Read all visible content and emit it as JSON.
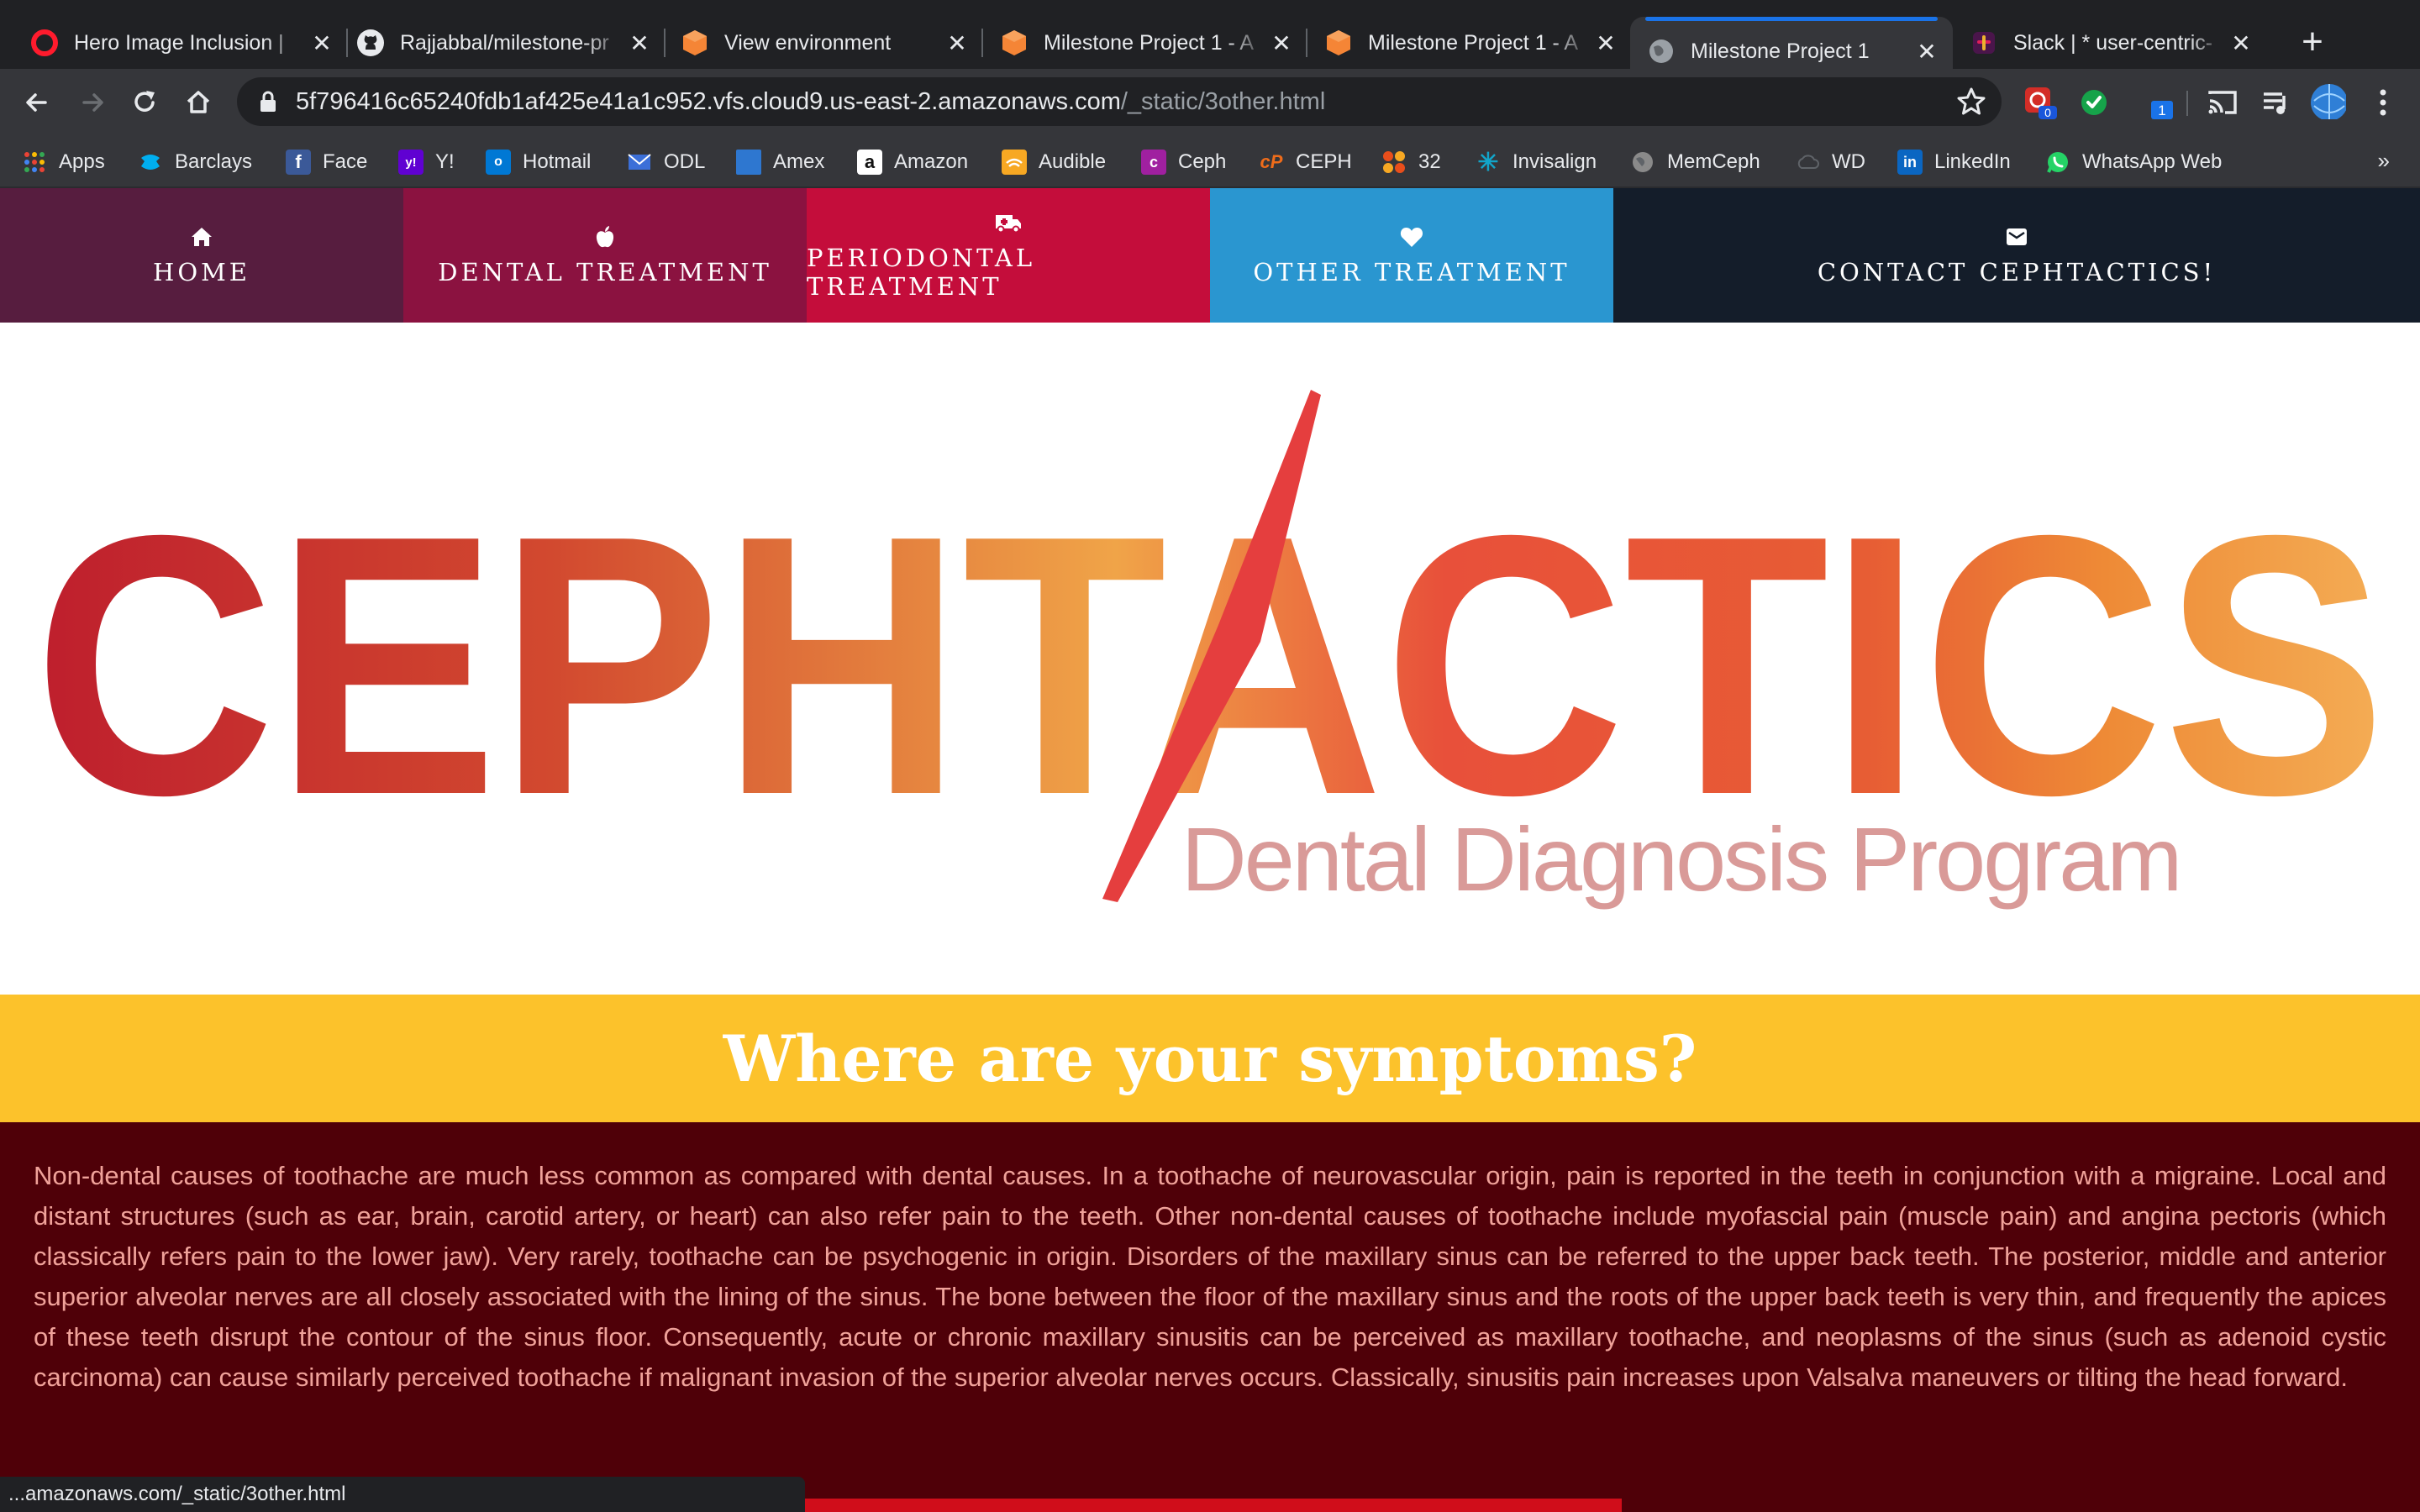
{
  "browser": {
    "tabs": [
      {
        "title": "Hero Image Inclusion |",
        "favicon": "opera-icon",
        "active": false
      },
      {
        "title": "Rajjabbal/milestone-pr",
        "favicon": "github-icon",
        "active": false
      },
      {
        "title": "View environment",
        "favicon": "aws-cube-icon",
        "active": false
      },
      {
        "title": "Milestone Project 1 - A",
        "favicon": "aws-cube-icon",
        "active": false
      },
      {
        "title": "Milestone Project 1 - A",
        "favicon": "aws-cube-icon",
        "active": false
      },
      {
        "title": "Milestone Project 1",
        "favicon": "globe-icon",
        "active": true
      },
      {
        "title": "Slack | * user-centric-",
        "favicon": "slack-icon",
        "active": false
      }
    ],
    "url_host": "5f796416c65240fdb1af425e41a1c952.vfs.cloud9.us-east-2.amazonaws.com",
    "url_path": "/_static/3other.html",
    "extension_badges": {
      "red": "0",
      "blue": "1"
    },
    "bookmarks": [
      {
        "label": "Apps",
        "icon": "apps-grid-icon",
        "color": "#ea4335"
      },
      {
        "label": "Barclays",
        "icon": "barclays-eagle-icon",
        "color": "#00aeef"
      },
      {
        "label": "Face",
        "icon": "facebook-icon",
        "color": "#3b5998"
      },
      {
        "label": "Y!",
        "icon": "yahoo-icon",
        "color": "#6001d2"
      },
      {
        "label": "Hotmail",
        "icon": "outlook-icon",
        "color": "#0078d4"
      },
      {
        "label": "ODL",
        "icon": "mail-icon",
        "color": "#3b6fd8"
      },
      {
        "label": "Amex",
        "icon": "amex-icon",
        "color": "#2e77d0"
      },
      {
        "label": "Amazon",
        "icon": "amazon-icon",
        "color": "#ffffff"
      },
      {
        "label": "Audible",
        "icon": "audible-icon",
        "color": "#f7a823"
      },
      {
        "label": "Ceph",
        "icon": "ceph-icon",
        "color": "#a020a0"
      },
      {
        "label": "CEPH",
        "icon": "ceph-orange-icon",
        "color": "#ef6c1a"
      },
      {
        "label": "32",
        "icon": "thirtytwo-icon",
        "color": "#e94e1b"
      },
      {
        "label": "Invisalign",
        "icon": "invisalign-icon",
        "color": "#12a5c9"
      },
      {
        "label": "MemCeph",
        "icon": "globe-icon",
        "color": "#8a8a8a"
      },
      {
        "label": "WD",
        "icon": "cloud-icon",
        "color": "#5f6368"
      },
      {
        "label": "LinkedIn",
        "icon": "linkedin-icon",
        "color": "#0a66c2"
      },
      {
        "label": "WhatsApp Web",
        "icon": "whatsapp-icon",
        "color": "#25d366"
      }
    ],
    "bookmarks_more": "»",
    "status_url": "...amazonaws.com/_static/3other.html"
  },
  "nav": {
    "items": [
      {
        "label": "HOME",
        "icon": "home-icon",
        "bg": "#571d3f"
      },
      {
        "label": "DENTAL TREATMENT",
        "icon": "apple-icon",
        "bg": "#8b1240"
      },
      {
        "label": "PERIODONTAL TREATMENT",
        "icon": "ambulance-icon",
        "bg": "#c40d3b"
      },
      {
        "label": "OTHER TREATMENT",
        "icon": "heart-icon",
        "bg": "#2a96d0"
      },
      {
        "label": "CONTACT CEPHTACTICS!",
        "icon": "envelope-icon",
        "bg": "#141d2a"
      }
    ]
  },
  "hero": {
    "logo_text": "CEPHTACTICS",
    "tagline": "Dental Diagnosis Program",
    "colors": {
      "start": "#be1e2d",
      "mid": "#e78a3e",
      "accent": "#e53e3e",
      "tagline": "#d99a98"
    }
  },
  "symptoms": {
    "heading": "Where are your symptoms?",
    "band_color": "#fcc22b",
    "body_bg": "#4f0008",
    "body_text": "Non-dental causes of toothache are much less common as compared with dental causes. In a toothache of neurovascular origin, pain is reported in the teeth in conjunction with a migraine. Local and distant structures (such as ear, brain, carotid artery, or heart) can also refer pain to the teeth. Other non-dental causes of toothache include myofascial pain (muscle pain) and angina pectoris (which classically refers pain to the lower jaw). Very rarely, toothache can be psychogenic in origin. Disorders of the maxillary sinus can be referred to the upper back teeth. The posterior, middle and anterior superior alveolar nerves are all closely associated with the lining of the sinus. The bone between the floor of the maxillary sinus and the roots of the upper back teeth is very thin, and frequently the apices of these teeth disrupt the contour of the sinus floor. Consequently, acute or chronic maxillary sinusitis can be perceived as maxillary toothache, and neoplasms of the sinus (such as adenoid cystic carcinoma) can cause similarly perceived toothache if malignant invasion of the superior alveolar nerves occurs. Classically, sinusitis pain increases upon Valsalva maneuvers or tilting the head forward."
  }
}
